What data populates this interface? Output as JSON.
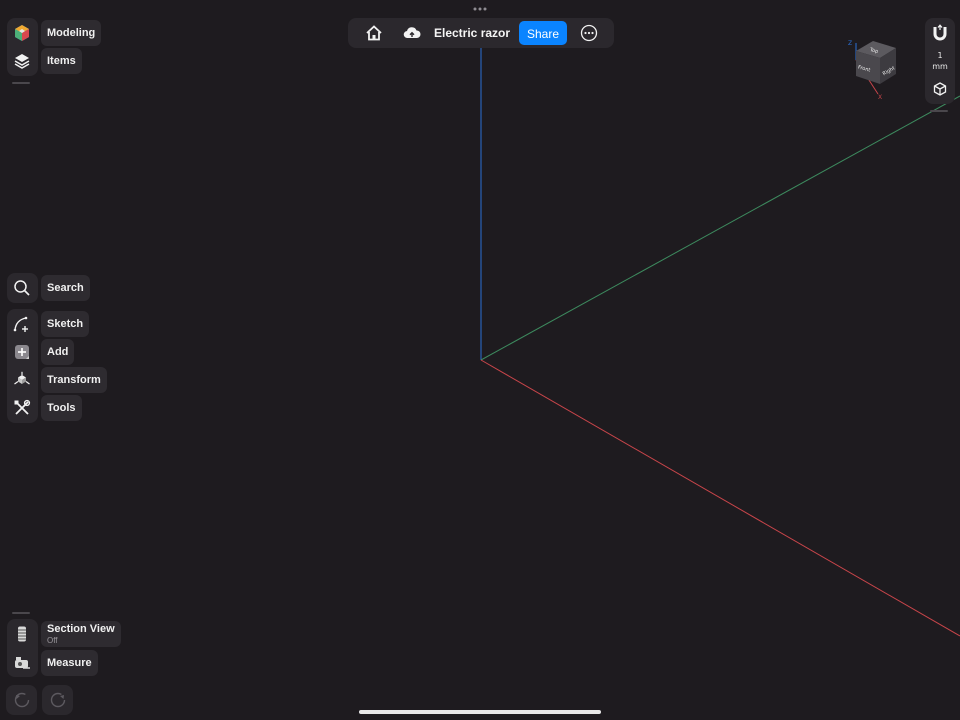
{
  "document": {
    "title": "Electric razor"
  },
  "topbar": {
    "share_label": "Share"
  },
  "left_panel": {
    "modeling_label": "Modeling",
    "items_label": "Items",
    "search_label": "Search",
    "sketch_label": "Sketch",
    "add_label": "Add",
    "transform_label": "Transform",
    "tools_label": "Tools",
    "section_view_label": "Section View",
    "section_view_state": "Off",
    "measure_label": "Measure"
  },
  "right_panel": {
    "unit_value": "1",
    "unit_name": "mm"
  },
  "viewcube": {
    "top_face": "Top",
    "front_face": "Front",
    "right_face": "Right",
    "z_axis": "Z",
    "x_axis": "X"
  },
  "colors": {
    "accent": "#0a84ff",
    "x_axis": "#c8454a",
    "y_axis": "#3d8a5e",
    "z_axis": "#2a6fd6",
    "background": "#1e1b1f"
  }
}
